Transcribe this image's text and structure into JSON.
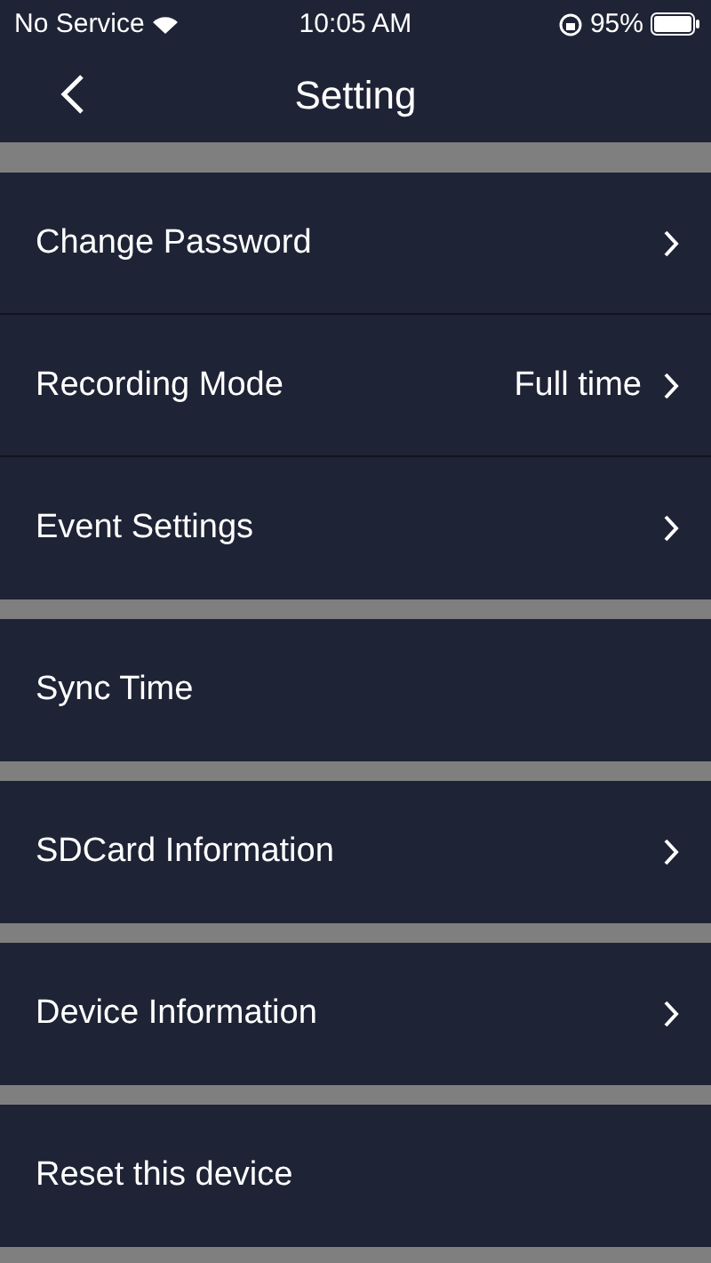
{
  "status_bar": {
    "carrier": "No Service",
    "time": "10:05 AM",
    "battery": "95%"
  },
  "nav": {
    "back": true,
    "title": "Setting"
  },
  "groups": [
    {
      "items": [
        {
          "label": "Change Password",
          "chevron": true
        },
        {
          "label": "Recording Mode",
          "value": "Full time",
          "chevron": true
        },
        {
          "label": "Event Settings",
          "chevron": true
        }
      ]
    },
    {
      "items": [
        {
          "label": "Sync Time",
          "chevron": false
        }
      ]
    },
    {
      "items": [
        {
          "label": "SDCard Information",
          "chevron": true
        }
      ]
    },
    {
      "items": [
        {
          "label": "Device Information",
          "chevron": true
        }
      ]
    },
    {
      "items": [
        {
          "label": "Reset this device",
          "chevron": false
        }
      ]
    }
  ]
}
